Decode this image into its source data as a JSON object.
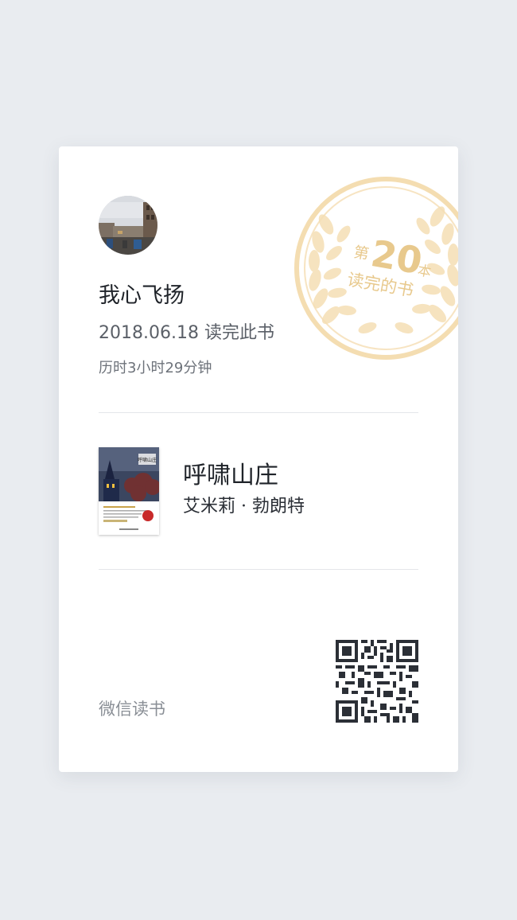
{
  "reader": {
    "name": "我心飞扬",
    "finish_text": "2018.06.18 读完此书",
    "duration_text": "历时3小时29分钟"
  },
  "badge": {
    "prefix": "第",
    "number": "20",
    "suffix": "本",
    "caption": "读完的书",
    "color": "#f3d9a8"
  },
  "book": {
    "title": "呼啸山庄",
    "author": "艾米莉 · 勃朗特",
    "cover_title": "呼啸山庄"
  },
  "footer": {
    "brand": "微信读书"
  },
  "colors": {
    "background": "#e9ecf0",
    "card": "#ffffff",
    "primary_text": "#1f2329",
    "secondary_text": "#5b6068",
    "badge_gold": "#f3d9a8"
  }
}
